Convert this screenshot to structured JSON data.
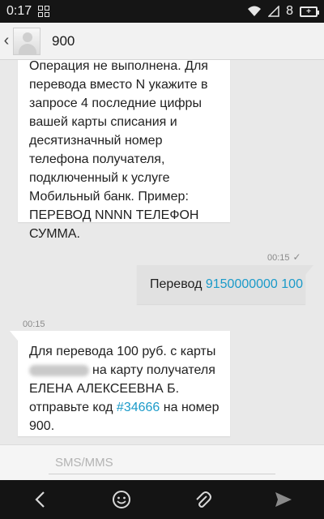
{
  "status_bar": {
    "time": "0:17",
    "battery_level": "8",
    "icons": [
      "grid-icon",
      "wifi-icon",
      "signal-icon",
      "battery-icon"
    ]
  },
  "header": {
    "contact": "900",
    "icons": [
      "back-chevron-icon",
      "avatar-icon"
    ]
  },
  "messages": [
    {
      "direction": "incoming",
      "lines": [
        "Операция не выполнена. Для",
        "перевода вместо N укажите в",
        "запросе 4 последние цифры",
        "вашей карты списания и",
        "десятизначный номер",
        "телефона  получателя,",
        "подключенный к услуге",
        "Мобильный банк. Пример:",
        "ПЕРЕВОД NNNN ТЕЛЕФОН",
        "СУММА."
      ]
    },
    {
      "direction": "outgoing",
      "time": "00:15",
      "prefix": "Перевод ",
      "link_text": "9150000000 100"
    },
    {
      "direction": "incoming",
      "time": "00:15",
      "line1": "Для перевода 100 руб. с карты",
      "line2_suffix": "на карту получателя",
      "line3": "ЕЛЕНА АЛЕКСЕЕВНА Б.",
      "line4_prefix": "отправьте код ",
      "code": "#34666",
      "line4_suffix": " на номер",
      "line5": "900."
    }
  ],
  "input": {
    "placeholder": "SMS/MMS"
  },
  "nav_bar": {
    "icons": [
      "back-arrow-icon",
      "emoji-icon",
      "attach-icon",
      "send-icon"
    ]
  },
  "colors": {
    "link": "#1a9ac9",
    "incoming_bubble": "#ffffff",
    "outgoing_bubble": "#e1e1e1"
  }
}
